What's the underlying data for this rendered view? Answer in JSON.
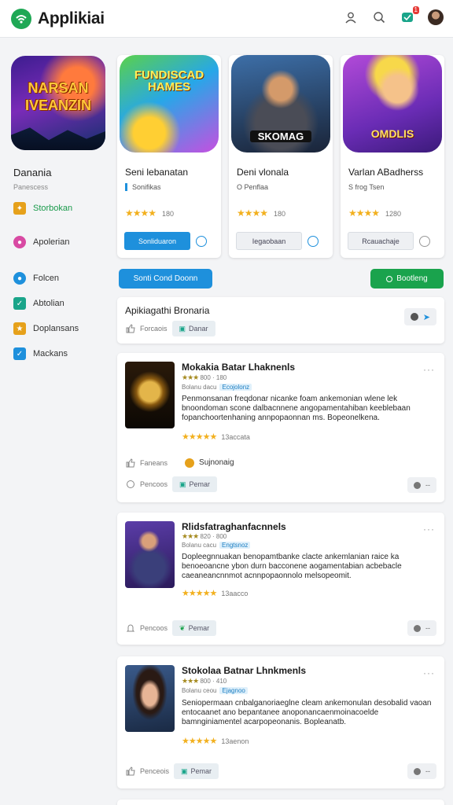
{
  "header": {
    "title": "Applikiai",
    "notification_count": "1",
    "icons": [
      "user-icon",
      "search-icon",
      "notification-icon",
      "avatar"
    ]
  },
  "sidebar": {
    "featured_art_text": "NARSAN IVEANZIN",
    "title": "Danania",
    "subtitle": "Panescess",
    "nav": [
      {
        "label": "Storbokan",
        "icon": "gift-icon",
        "color": "#e6a11b",
        "active": true
      },
      {
        "label": "Apolerian",
        "icon": "palette-icon",
        "color": "#d84aa3",
        "active": false
      },
      {
        "label": "Folcen",
        "icon": "folder-icon",
        "color": "#1e90dc",
        "active": false
      },
      {
        "label": "Abtolian",
        "icon": "check-icon",
        "color": "#1aa58a",
        "active": false
      },
      {
        "label": "Doplansans",
        "icon": "star-box-icon",
        "color": "#e6a11b",
        "active": false
      },
      {
        "label": "Mackans",
        "icon": "check-box-icon",
        "color": "#1e90dc",
        "active": false
      }
    ]
  },
  "apps": [
    {
      "art_text": "FUNDISCAD HAMES",
      "title": "Seni lebanatan",
      "developer": "Sonifikas",
      "stars": "★★★★",
      "count": "180",
      "button": "Sonliduaron",
      "button_style": "primary"
    },
    {
      "art_text": "SKOMAG",
      "title": "Deni vlonala",
      "developer": "O Penflaa",
      "stars": "★★★★",
      "count": "180",
      "button": "Iegaobaan",
      "button_style": "ghost"
    },
    {
      "art_text": "OMDLIS",
      "title": "Varlan ABadherss",
      "developer": "S frog Tsen",
      "stars": "★★★★",
      "count": "1280",
      "button": "Rcauachaje",
      "button_style": "ghost"
    }
  ],
  "actions": {
    "left_label": "Sonti Cond Doonn",
    "right_label": "Bootleng"
  },
  "section": {
    "title": "Apikiagathi Bronaria",
    "meta": "Forcaois",
    "chip": "Danar"
  },
  "posts": [
    {
      "title": "Mokakia Batar Lhaknenls",
      "rating_stars": "★★★",
      "rating_text": "800 · 180",
      "byline": "Bolanu dacu",
      "tag": "Ecojolonz",
      "body": "Penmonsanan freqdonar nicanke foam ankemonian wlene lek bnoondoman scone dalbacnnene angopamentahiban keeblebaan fopanchoortenhaning annpopaonnan ms. Bopeonelkena.",
      "stars": "★★★★★",
      "count": "13accata",
      "extra": "Sujnonaig",
      "meta1": "Faneans",
      "meta2": "Pencoos",
      "chip": "Pemar"
    },
    {
      "title": "Rlidsfatraghanfacnnels",
      "rating_stars": "★★★",
      "rating_text": "820 · 800",
      "byline": "Bolanu cacu",
      "tag": "Engtsnoz",
      "body": "Dopleegnnuakan benopamtbanke clacte ankemlanian raice ka benoeoancne ybon durn bacconene aogamentabian acbebacle caeaneancnnmot acnnpopaonnolo melsopeomit.",
      "stars": "★★★★★",
      "count": "13aacco",
      "meta2": "Pencoos",
      "chip": "Pemar"
    },
    {
      "title": "Stokolaa Batnar Lhnkmenls",
      "rating_stars": "★★★",
      "rating_text": "800 · 410",
      "byline": "Bolanu ceou",
      "tag": "Ejagnoo",
      "body": "Seniopermaan cnbalganoriaeglne cleam ankemonulan desobalid vaoan entocaanet ano bepantanee anoponancaenmoinacoelde bamnginiamentel acarpopeonanis. Bopleanatb.",
      "stars": "★★★★★",
      "count": "13aenon",
      "meta2": "Penceois",
      "chip": "Pemar"
    }
  ]
}
